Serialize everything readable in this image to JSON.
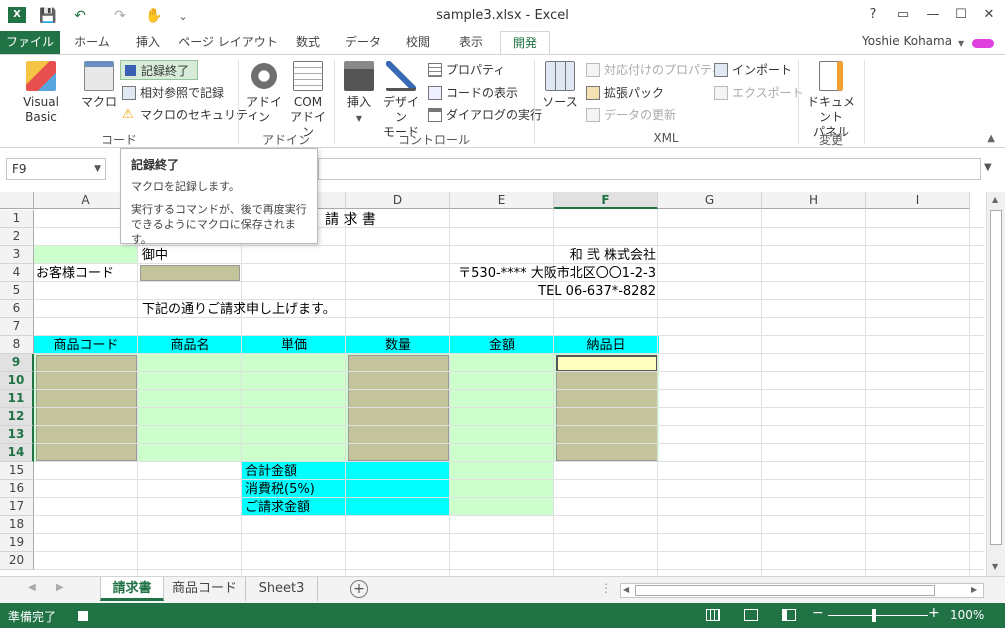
{
  "window": {
    "title": "sample3.xlsx - Excel",
    "help": "?",
    "minimize": "—",
    "maximize": "☐",
    "close": "✕"
  },
  "qat": {
    "save": "💾",
    "undo": "↶",
    "redo": "↷",
    "touch": "✋",
    "more": "⌄"
  },
  "tabs": [
    {
      "label": "ファイル"
    },
    {
      "label": "ホーム"
    },
    {
      "label": "挿入"
    },
    {
      "label": "ページ レイアウト"
    },
    {
      "label": "数式"
    },
    {
      "label": "データ"
    },
    {
      "label": "校閲"
    },
    {
      "label": "表示"
    },
    {
      "label": "開発"
    }
  ],
  "user": {
    "name": "Yoshie Kohama"
  },
  "ribbon": {
    "code": {
      "label": "コード",
      "visual_basic": "Visual Basic",
      "macro": "マクロ",
      "record_stop": "記録終了",
      "relative_ref": "相対参照で記録",
      "macro_security": "マクロのセキュリティ"
    },
    "addin": {
      "label": "アドイン",
      "addin": "アドイン",
      "com_addin_1": "COM",
      "com_addin_2": "アドイン"
    },
    "control": {
      "label": "コントロール",
      "insert": "挿入",
      "design_mode_1": "デザイン",
      "design_mode_2": "モード",
      "properties": "プロパティ",
      "view_code": "コードの表示",
      "run_dialog": "ダイアログの実行"
    },
    "xml": {
      "label": "XML",
      "source": "ソース",
      "map_properties": "対応付けのプロパティ",
      "expansion_packs": "拡張パック",
      "refresh_data": "データの更新",
      "import": "インポート",
      "export": "エクスポート"
    },
    "modify": {
      "label": "変更",
      "doc_panel_1": "ドキュメント",
      "doc_panel_2": "パネル"
    }
  },
  "formula_bar": {
    "name_box": "F9",
    "formula": ""
  },
  "tooltip": {
    "title": "記録終了",
    "line1": "マクロを記録します。",
    "line2": "実行するコマンドが、後で再度実行",
    "line3": "できるようにマクロに保存されます。"
  },
  "grid": {
    "columns": [
      "A",
      "B",
      "C",
      "D",
      "E",
      "F",
      "G",
      "H",
      "I"
    ],
    "rows": [
      "1",
      "2",
      "3",
      "4",
      "5",
      "6",
      "7",
      "8",
      "9",
      "10",
      "11",
      "12",
      "13",
      "14",
      "15",
      "16",
      "17",
      "18",
      "19",
      "20"
    ],
    "cells": {
      "title": "請 求 書",
      "onchu": "御中",
      "company": "和 弐 株式会社",
      "customer_code_label": "お客様コード",
      "address": "〒530-****  大阪市北区〇〇1-2-3",
      "tel": "TEL  06-637*-8282",
      "greeting": "下記の通りご請求申し上げます。",
      "headers": [
        "商品コード",
        "商品名",
        "単価",
        "数量",
        "金額",
        "納品日"
      ],
      "total_label": "合計金額",
      "tax_label": "消費税(5%)",
      "billing_label": "ご請求金額"
    }
  },
  "sheets": [
    {
      "name": "請求書"
    },
    {
      "name": "商品コード"
    },
    {
      "name": "Sheet3"
    }
  ],
  "status": {
    "ready": "準備完了",
    "zoom": "100%"
  },
  "colors": {
    "excel_green": "#217346",
    "cyan": "#00ffff",
    "light_green": "#ccffcc",
    "khaki": "#c4c49c",
    "light_yellow": "#ffffc0"
  }
}
